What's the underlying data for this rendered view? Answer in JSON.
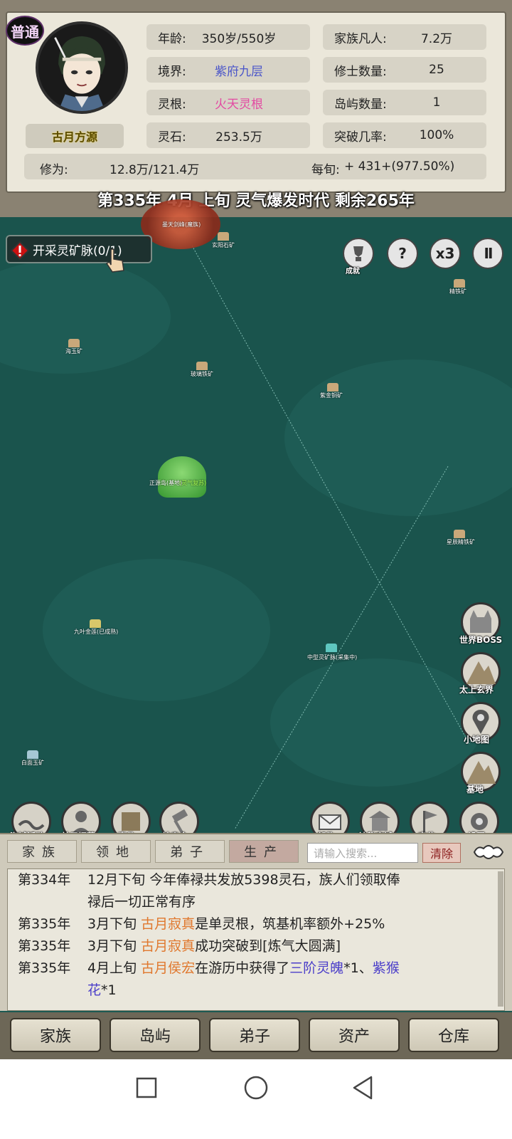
{
  "character": {
    "grade": "普通",
    "name": "古月方源",
    "stats": [
      {
        "key": "年龄:",
        "value": "350岁/550岁",
        "color": "default"
      },
      {
        "key": "境界:",
        "value": "紫府九层",
        "color": "blue"
      },
      {
        "key": "灵根:",
        "value": "火天灵根",
        "color": "pink"
      },
      {
        "key": "灵石:",
        "value": "253.5万",
        "color": "default"
      }
    ],
    "family_stats": [
      {
        "key": "家族凡人:",
        "value": "7.2万"
      },
      {
        "key": "修士数量:",
        "value": "25"
      },
      {
        "key": "岛屿数量:",
        "value": "1"
      },
      {
        "key": "突破几率:",
        "value": "100%"
      }
    ],
    "cultivation_label": "修为:",
    "cultivation_value": "12.8万/121.4万",
    "per_xun_label": "每旬:",
    "per_xun_value": "+ 431+(977.50%)"
  },
  "banner": "第335年 4月 上旬  灵气爆发时代 剩余265年",
  "quest": {
    "text": "开采灵矿脉(0/1)"
  },
  "top_buttons": {
    "achievement": "成就",
    "help": "?",
    "speed": "x3",
    "pause": "II"
  },
  "map_labels": {
    "l1": "墨天剑峰(魔族)",
    "l2": "玄阳石矿",
    "l3": "精铁矿",
    "l4": "海玉矿",
    "l5": "玻璃铁矿",
    "l6": "紫金铜矿",
    "l7": "正源岛(基地)",
    "l7b": "(灵气复苏)",
    "l8": "星辰精铁矿",
    "l9": "九叶金莲(已成熟)",
    "l10": "中型灵矿脉(采集中)",
    "l11": "白面玉矿",
    "l12": "基地"
  },
  "side_buttons": [
    {
      "label": "世界BOSS"
    },
    {
      "label": "太上玄界"
    },
    {
      "label": "小地图"
    },
    {
      "label": "基地"
    }
  ],
  "bottom_map_buttons": [
    {
      "label": "海域活动"
    },
    {
      "label": "弟子招募"
    },
    {
      "label": "事件"
    },
    {
      "label": "拍卖会"
    },
    {
      "label": "邮件"
    },
    {
      "label": "神秘店铺"
    },
    {
      "label": "定位"
    },
    {
      "label": "设置"
    }
  ],
  "tabs": [
    {
      "label": "家族"
    },
    {
      "label": "领地"
    },
    {
      "label": "弟子"
    },
    {
      "label": "生产"
    }
  ],
  "search": {
    "placeholder": "请输入搜索..."
  },
  "clear_label": "清除",
  "log": [
    {
      "year": "第334年",
      "line1": "12月下旬 今年俸禄共发放5398灵石，族人们领取俸",
      "line2": "禄后一切正常有序"
    },
    {
      "year": "第335年",
      "month": "3月下旬",
      "name": "古月寂真",
      "rest": "是单灵根，筑基机率额外+25%"
    },
    {
      "year": "第335年",
      "month": "3月下旬",
      "name": "古月寂真",
      "rest": "成功突破到[炼气大圆满]"
    },
    {
      "year": "第335年",
      "month": "4月上旬",
      "name": "古月侯宏",
      "mid": "在游历中获得了",
      "item1": "三阶灵魄",
      "mid2": "*1、",
      "item2": "紫猴",
      "line2_item": "花",
      "line2_rest": "*1"
    }
  ],
  "nav": [
    {
      "label": "家族"
    },
    {
      "label": "岛屿"
    },
    {
      "label": "弟子"
    },
    {
      "label": "资产"
    },
    {
      "label": "仓库"
    }
  ]
}
